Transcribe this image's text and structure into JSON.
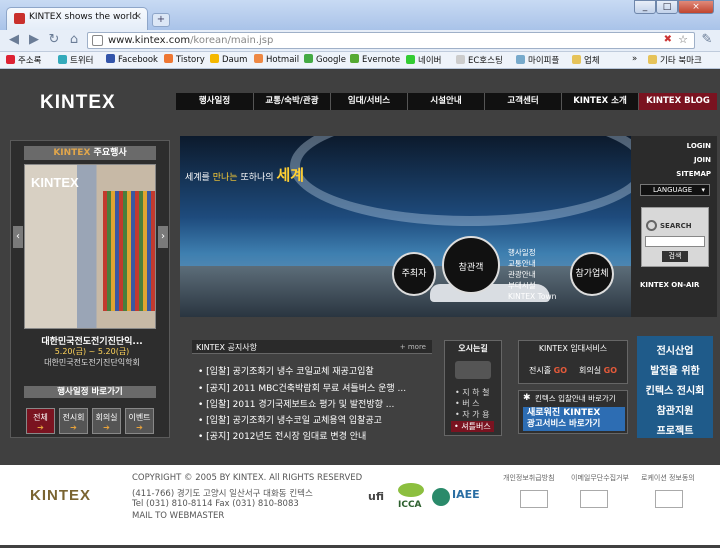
{
  "browser": {
    "tab_title": "KINTEX shows the world",
    "tab_close": "×",
    "new_tab": "+",
    "win_min": "_",
    "win_max": "□",
    "win_close": "×",
    "url_host": "www.kintex.com",
    "url_path": "/korean/main.jsp",
    "bookmarks": [
      "주소록",
      "트위터",
      "Facebook",
      "Tistory",
      "Daum",
      "Hotmail",
      "Google",
      "Evernote",
      "네이버",
      "EC호스팅",
      "마이피플",
      "업체"
    ],
    "more": "»",
    "other_bookmarks": "기타 북마크"
  },
  "site": {
    "logo": "KINTEX",
    "nav": [
      "행사일정",
      "교통/숙박/관광",
      "임대/서비스",
      "시설안내",
      "고객센터",
      "KINTEX 소개",
      "KINTEX BLOG"
    ],
    "util": [
      "LOGIN",
      "JOIN",
      "SITEMAP"
    ],
    "language": "LANGUAGE",
    "search_label": "SEARCH",
    "search_btn": "검색",
    "onair": "KINTEX ON-AIR",
    "main_events_title_a": "KINTEX",
    "main_events_title_b": "주요행사",
    "event_img_text": "KINTEX",
    "event_name": "대한민국전도전기진단익...",
    "event_date": "5.20(금) ~ 5.20(금)",
    "event_org": "대한민국전도전기진단익학회",
    "quick_title": "행사일정 바로가기",
    "quick_btns": [
      "전체",
      "전시회",
      "회의실",
      "이벤트"
    ],
    "hero_text_a": "세계를",
    "hero_text_b": "만나는",
    "hero_text_c": "또하나의",
    "hero_text_d": "세계",
    "hero_circles": [
      "주최자",
      "참관객",
      "참가업체"
    ],
    "hero_menu": [
      "행사일정",
      "교통안내",
      "관광안내",
      "부대시설",
      "KINTEX Town"
    ],
    "notice_title": "KINTEX 공지사항",
    "notice_more": "+ more",
    "notices": [
      "[입찰] 공기조화기 냉수 코일교체 재공고입찰",
      "[공지] 2011 MBC건축박람회 무료 셔틀버스 운행 ...",
      "[입찰] 2011 경기국제보트쇼 평가 및 발전방향 ...",
      "[입찰] 공기조화기 냉수코일 교체용역 입찰공고",
      "[공지] 2012년도 전시장 임대료 변경 안내"
    ],
    "directions_title": "오시는길",
    "directions": [
      "지 하 철",
      "버 스",
      "자 가 용",
      "셔틀버스"
    ],
    "rental_title": "KINTEX 임대서비스",
    "rental_a": "전시홀",
    "rental_b": "회의실",
    "rental_go": "GO",
    "webzine_small": "킨텍스 입찰안내 바로가기",
    "webzine_a": "새로워진 KINTEX",
    "webzine_b": "광고서비스 바로가기",
    "campaign": [
      "전시산업",
      "발전을 위한",
      "킨텍스 전시회",
      "참관지원",
      "프로젝트"
    ],
    "footer_logo": "KINTEX",
    "footer_lines": [
      "COPYRIGHT © 2005 BY KINTEX. All RIGHTS RESERVED",
      "(411-766) 경기도 고양시 일산서구 대화동 킨텍스",
      "Tel (031) 810-8114 Fax (031) 810-8083",
      "MAIL TO WEBMASTER"
    ],
    "footer_links": [
      "개인정보취급방침",
      "이메일무단수집거부",
      "로케이션 정보동의"
    ],
    "footer_logos": [
      "ufi",
      "ICCA",
      "IAEE"
    ]
  }
}
